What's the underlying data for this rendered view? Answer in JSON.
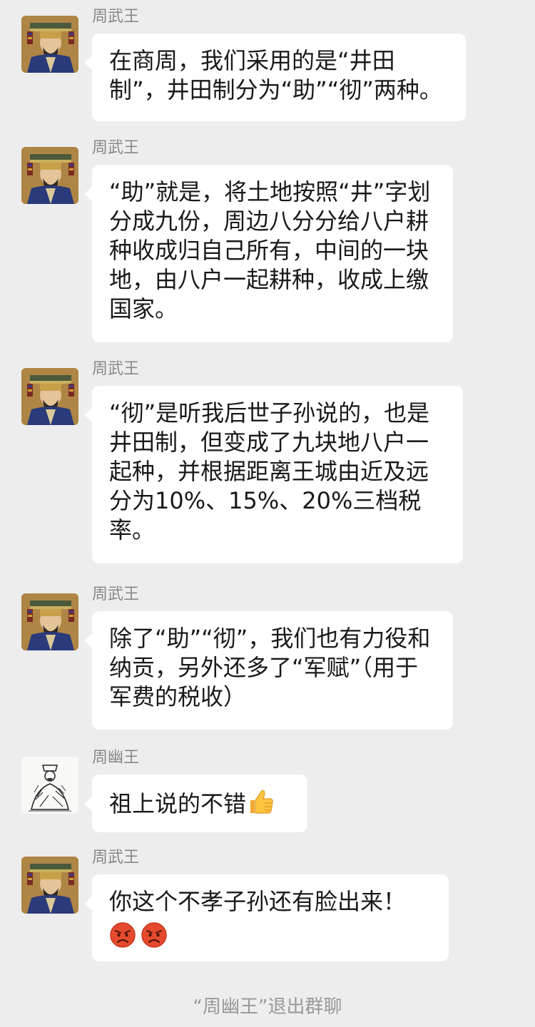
{
  "messages": [
    {
      "sender": "周武王",
      "avatar": "king-wu-portrait",
      "text": "在商周，我们采用的是“井田制”，井田制分为“助”“彻”两种。"
    },
    {
      "sender": "周武王",
      "avatar": "king-wu-portrait",
      "text": "“助”就是，将土地按照“井”字划分成九份，周边八分分给八户耕种收成归自己所有，中间的一块地，由八户一起耕种，收成上缴国家。"
    },
    {
      "sender": "周武王",
      "avatar": "king-wu-portrait",
      "text": "“彻”是听我后世子孙说的，也是井田制，但变成了九块地八户一起种，并根据距离王城由近及远分为10%、15%、20%三档税率。"
    },
    {
      "sender": "周武王",
      "avatar": "king-wu-portrait",
      "text": "除了“助”“彻”，我们也有力役和纳贡，另外还多了“军赋”（用于军费的税收）"
    },
    {
      "sender": "周幽王",
      "avatar": "king-you-sketch",
      "text": "祖上说的不错",
      "emoji": "thumbs-up-icon"
    },
    {
      "sender": "周武王",
      "avatar": "king-wu-portrait",
      "text": "你这个不孝子孙还有脸出来！",
      "emojis": [
        "angry-face-icon",
        "angry-face-icon"
      ]
    }
  ],
  "system_notice": "“周幽王”退出群聊",
  "colors": {
    "background": "#ededed",
    "bubble": "#ffffff",
    "sender": "#888888",
    "text": "#191919",
    "system": "#999999"
  }
}
